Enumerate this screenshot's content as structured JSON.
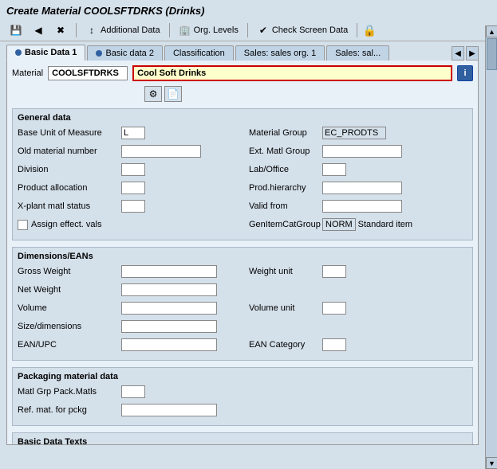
{
  "title": "Create Material COOLSFTDRKS (Drinks)",
  "toolbar": {
    "additional_data": "Additional Data",
    "org_levels": "Org. Levels",
    "check_screen_data": "Check Screen Data"
  },
  "tabs": [
    {
      "label": "Basic Data 1",
      "active": true,
      "dot": true
    },
    {
      "label": "Basic data 2",
      "active": false,
      "dot": true
    },
    {
      "label": "Classification",
      "active": false,
      "dot": false
    },
    {
      "label": "Sales: sales org. 1",
      "active": false,
      "dot": false
    },
    {
      "label": "Sales: sal...",
      "active": false,
      "dot": false
    }
  ],
  "material": {
    "label": "Material",
    "code": "COOLSFTDRKS",
    "name": "Cool Soft Drinks"
  },
  "general_data": {
    "title": "General data",
    "base_unit_label": "Base Unit of Measure",
    "base_unit_value": "L",
    "material_group_label": "Material Group",
    "material_group_value": "EC_PRODTS",
    "old_material_label": "Old material number",
    "old_material_value": "",
    "ext_matl_label": "Ext. Matl Group",
    "ext_matl_value": "",
    "division_label": "Division",
    "division_value": "",
    "lab_office_label": "Lab/Office",
    "lab_office_value": "",
    "product_alloc_label": "Product allocation",
    "product_alloc_value": "",
    "prod_hierarchy_label": "Prod.hierarchy",
    "prod_hierarchy_value": "",
    "xplant_label": "X-plant matl status",
    "xplant_value": "",
    "valid_from_label": "Valid from",
    "valid_from_value": "",
    "assign_label": "Assign effect. vals",
    "gen_item_label": "GenItemCatGroup",
    "gen_item_value": "NORM",
    "standard_item_label": "Standard item"
  },
  "dimensions": {
    "title": "Dimensions/EANs",
    "gross_weight_label": "Gross Weight",
    "gross_weight_value": "",
    "weight_unit_label": "Weight unit",
    "weight_unit_value": "",
    "net_weight_label": "Net Weight",
    "net_weight_value": "",
    "volume_label": "Volume",
    "volume_value": "",
    "volume_unit_label": "Volume unit",
    "volume_unit_value": "",
    "size_label": "Size/dimensions",
    "size_value": "",
    "ean_label": "EAN/UPC",
    "ean_value": "",
    "ean_category_label": "EAN Category",
    "ean_category_value": ""
  },
  "packaging": {
    "title": "Packaging material data",
    "matl_grp_label": "Matl Grp Pack.Matls",
    "matl_grp_value": "",
    "ref_mat_label": "Ref. mat. for pckg",
    "ref_mat_value": ""
  },
  "basic_data_texts": {
    "title": "Basic Data Texts"
  }
}
